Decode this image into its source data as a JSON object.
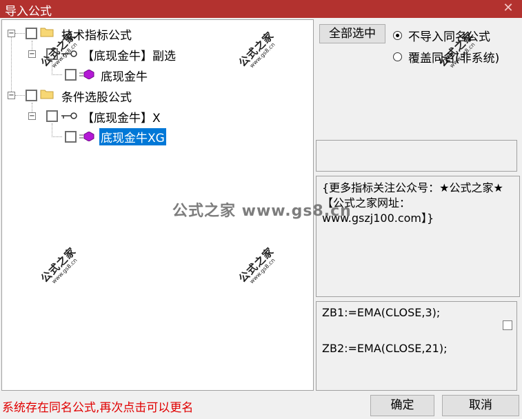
{
  "window": {
    "title": "导入公式",
    "close_glyph": "✕"
  },
  "tree": {
    "nodes": [
      {
        "label": "技术指标公式",
        "icon": "folder-icon"
      },
      {
        "label": "【底现金牛】副选",
        "icon": "key-icon"
      },
      {
        "label": "底现金牛",
        "icon": "gem-icon"
      },
      {
        "label": "条件选股公式",
        "icon": "folder-icon"
      },
      {
        "label": "【底现金牛】X",
        "icon": "key-icon"
      },
      {
        "label": "底现金牛XG",
        "icon": "gem-icon",
        "selected": true
      }
    ],
    "expander_glyph": "−"
  },
  "watermark": {
    "brand": "公式之家",
    "url": "www.gs8.cn",
    "center": "公式之家 www.gs8.cn"
  },
  "options": {
    "select_all_label": "全部选中",
    "radio_skip_label": "不导入同名公式",
    "radio_overwrite_label": "覆盖同名(非系统)"
  },
  "description": "{更多指标关注公众号：★公式之家★ 【公式之家网址：www.gszj100.com】}",
  "code": {
    "line1": "ZB1:=EMA(CLOSE,3);",
    "line2": "ZB2:=EMA(CLOSE,21);"
  },
  "footer": {
    "status": "系统存在同名公式,再次点击可以更名",
    "ok_label": "确定",
    "cancel_label": "取消"
  },
  "colors": {
    "titlebar": "#b3322f",
    "selection": "#0078d7",
    "status_text": "#e00000"
  }
}
